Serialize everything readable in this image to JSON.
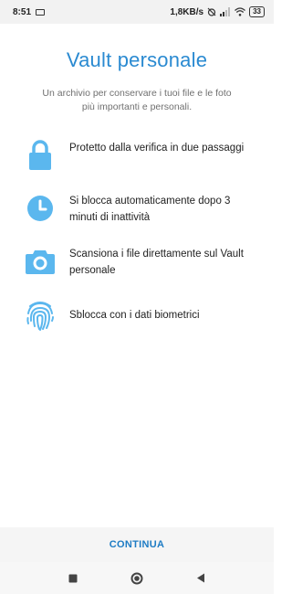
{
  "status_bar": {
    "time": "8:51",
    "network_speed": "1,8KB/s",
    "battery": "33"
  },
  "title": "Vault personale",
  "subtitle": "Un archivio per conservare i tuoi file e le foto più importanti e personali.",
  "features": [
    {
      "icon": "lock-icon",
      "text": "Protetto dalla verifica in due passaggi"
    },
    {
      "icon": "clock-icon",
      "text": "Si blocca automaticamente dopo 3 minuti di inattività"
    },
    {
      "icon": "camera-icon",
      "text": "Scansiona i file direttamente sul Vault personale"
    },
    {
      "icon": "fingerprint-icon",
      "text": "Sblocca con i dati biometrici"
    }
  ],
  "continue_label": "CONTINUA",
  "colors": {
    "accent": "#2a8ad1",
    "icon": "#5bb7ee"
  }
}
